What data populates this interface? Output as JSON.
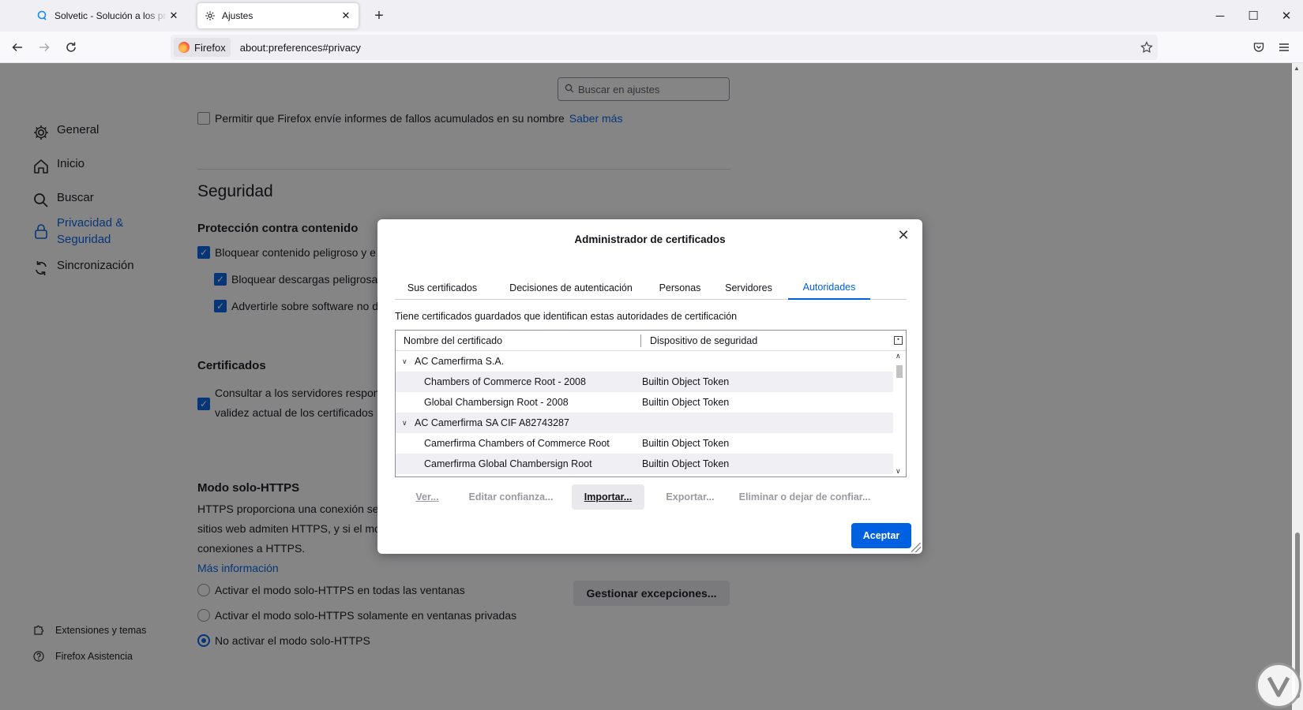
{
  "tabs": [
    {
      "title": "Solvetic - Solución a los problemas",
      "close": "✕"
    },
    {
      "title": "Ajustes",
      "close": "✕"
    }
  ],
  "newtab_label": "+",
  "window_controls": {
    "minimize": "─",
    "maximize": "☐",
    "close": "✕"
  },
  "nav": {
    "back_icon": "arrow-left-icon",
    "forward_icon": "arrow-right-icon",
    "reload_icon": "reload-icon",
    "identity_label": "Firefox",
    "url": "about:preferences#privacy",
    "bookmark_icon": "star-icon",
    "pocket_icon": "pocket-icon",
    "menu_icon": "hamburger-icon"
  },
  "search": {
    "placeholder": "Buscar en ajustes"
  },
  "sidebar": {
    "items": [
      {
        "label": "General",
        "icon": "gear-icon"
      },
      {
        "label": "Inicio",
        "icon": "home-icon"
      },
      {
        "label": "Buscar",
        "icon": "search-icon"
      },
      {
        "label": "Privacidad &\nSeguridad",
        "icon": "lock-icon",
        "selected": true
      },
      {
        "label": "Sincronización",
        "icon": "sync-icon"
      }
    ],
    "footer": [
      {
        "label": "Extensiones y temas",
        "icon": "puzzle-icon"
      },
      {
        "label": "Firefox Asistencia",
        "icon": "help-icon"
      }
    ]
  },
  "content": {
    "crash_reports_label": "Permitir que Firefox envíe informes de fallos acumulados en su nombre",
    "crash_reports_link": "Saber más",
    "security_heading": "Seguridad",
    "protection_heading": "Protección contra contenido",
    "block_dangerous": "Bloquear contenido peligroso y e",
    "block_downloads": "Bloquear descargas peligrosas",
    "warn_software": "Advertirle sobre software no d",
    "certificates_heading": "Certificados",
    "ocsp_line1": "Consultar a los servidores respon",
    "ocsp_line2": "validez actual de los certificados",
    "https_heading": "Modo solo-HTTPS",
    "https_line1": "HTTPS proporciona una conexión seg",
    "https_line2": "sitios web admiten HTTPS, y si el mo",
    "https_line3": "conexiones a HTTPS.",
    "more_info": "Más información",
    "https_options": [
      "Activar el modo solo-HTTPS en todas las ventanas",
      "Activar el modo solo-HTTPS solamente en ventanas privadas",
      "No activar el modo solo-HTTPS"
    ],
    "https_selected": 2,
    "manage_exceptions": "Gestionar excepciones..."
  },
  "dialog": {
    "title": "Administrador de certificados",
    "close": "✕",
    "tabs": [
      "Sus certificados",
      "Decisiones de autenticación",
      "Personas",
      "Servidores",
      "Autoridades"
    ],
    "selected_tab": "Autoridades",
    "description": "Tiene certificados guardados que identifican estas autoridades de certificación",
    "columns": [
      "Nombre del certificado",
      "Dispositivo de seguridad"
    ],
    "rows": [
      {
        "type": "group",
        "name": "AC Camerfirma S.A.",
        "device": ""
      },
      {
        "type": "child",
        "name": "Chambers of Commerce Root - 2008",
        "device": "Builtin Object Token"
      },
      {
        "type": "child",
        "name": "Global Chambersign Root - 2008",
        "device": "Builtin Object Token"
      },
      {
        "type": "group",
        "name": "AC Camerfirma SA CIF A82743287",
        "device": ""
      },
      {
        "type": "child",
        "name": "Camerfirma Chambers of Commerce Root",
        "device": "Builtin Object Token"
      },
      {
        "type": "child",
        "name": "Camerfirma Global Chambersign Root",
        "device": "Builtin Object Token"
      }
    ],
    "buttons": {
      "view": "Ver...",
      "edit_trust": "Editar confianza...",
      "import": "Importar...",
      "export": "Exportar...",
      "delete": "Eliminar o dejar de confiar..."
    },
    "ok": "Aceptar"
  },
  "colors": {
    "accent": "#0061e0",
    "overlay": "rgba(12,12,13,0.5)"
  }
}
